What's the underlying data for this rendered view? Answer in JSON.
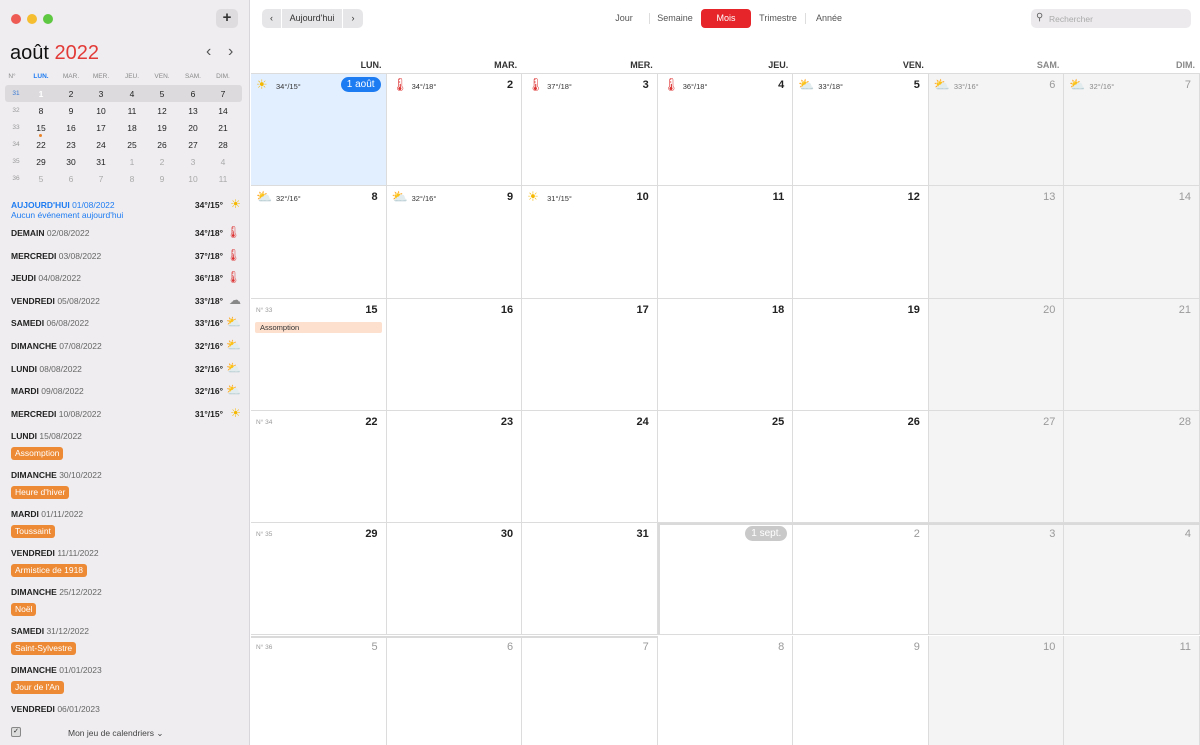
{
  "sidebar": {
    "add_label": "+",
    "month": "août",
    "year": "2022",
    "nav_prev": "‹",
    "nav_next": "›",
    "mini_headers": [
      "N°",
      "LUN.",
      "MAR.",
      "MER.",
      "JEU.",
      "VEN.",
      "SAM.",
      "DIM."
    ],
    "mini_weeks": [
      {
        "wk": "31",
        "days": [
          "1",
          "2",
          "3",
          "4",
          "5",
          "6",
          "7"
        ]
      },
      {
        "wk": "32",
        "days": [
          "8",
          "9",
          "10",
          "11",
          "12",
          "13",
          "14"
        ]
      },
      {
        "wk": "33",
        "days": [
          "15",
          "16",
          "17",
          "18",
          "19",
          "20",
          "21"
        ]
      },
      {
        "wk": "34",
        "days": [
          "22",
          "23",
          "24",
          "25",
          "26",
          "27",
          "28"
        ]
      },
      {
        "wk": "35",
        "days": [
          "29",
          "30",
          "31",
          "1",
          "2",
          "3",
          "4"
        ]
      },
      {
        "wk": "36",
        "days": [
          "5",
          "6",
          "7",
          "8",
          "9",
          "10",
          "11"
        ]
      }
    ],
    "today_label": "AUJOURD'HUI",
    "today_date": "01/08/2022",
    "today_temp": "34°/15°",
    "today_note": "Aucun événement aujourd'hui",
    "forecast": [
      {
        "day": "DEMAIN",
        "date": "02/08/2022",
        "temp": "34°/18°",
        "icon": "thermometer"
      },
      {
        "day": "MERCREDI",
        "date": "03/08/2022",
        "temp": "37°/18°",
        "icon": "thermometer"
      },
      {
        "day": "JEUDI",
        "date": "04/08/2022",
        "temp": "36°/18°",
        "icon": "thermometer"
      },
      {
        "day": "VENDREDI",
        "date": "05/08/2022",
        "temp": "33°/18°",
        "icon": "cloud"
      },
      {
        "day": "SAMEDI",
        "date": "06/08/2022",
        "temp": "33°/16°",
        "icon": "partly-cloudy"
      },
      {
        "day": "DIMANCHE",
        "date": "07/08/2022",
        "temp": "32°/16°",
        "icon": "partly-cloudy"
      },
      {
        "day": "LUNDI",
        "date": "08/08/2022",
        "temp": "32°/16°",
        "icon": "partly-cloudy"
      },
      {
        "day": "MARDI",
        "date": "09/08/2022",
        "temp": "32°/16°",
        "icon": "partly-cloudy"
      },
      {
        "day": "MERCREDI",
        "date": "10/08/2022",
        "temp": "31°/15°",
        "icon": "sun"
      }
    ],
    "holidays": [
      {
        "day": "LUNDI",
        "date": "15/08/2022",
        "tag": "Assomption"
      },
      {
        "day": "DIMANCHE",
        "date": "30/10/2022",
        "tag": "Heure d'hiver"
      },
      {
        "day": "MARDI",
        "date": "01/11/2022",
        "tag": "Toussaint"
      },
      {
        "day": "VENDREDI",
        "date": "11/11/2022",
        "tag": "Armistice de 1918"
      },
      {
        "day": "DIMANCHE",
        "date": "25/12/2022",
        "tag": "Noël"
      },
      {
        "day": "SAMEDI",
        "date": "31/12/2022",
        "tag": "Saint-Sylvestre"
      },
      {
        "day": "DIMANCHE",
        "date": "01/01/2023",
        "tag": "Jour de l'An"
      },
      {
        "day": "VENDREDI",
        "date": "06/01/2023",
        "tag": ""
      }
    ],
    "calendar_set": "Mon jeu de calendriers"
  },
  "toolbar": {
    "prev": "‹",
    "today": "Aujourd'hui",
    "next": "›",
    "views": [
      "Jour",
      "Semaine",
      "Mois",
      "Trimestre",
      "Année"
    ],
    "active_view": "Mois",
    "search_placeholder": "Rechercher"
  },
  "grid": {
    "headers": [
      "LUN.",
      "MAR.",
      "MER.",
      "JEU.",
      "VEN.",
      "SAM.",
      "DIM."
    ],
    "weeks": [
      {
        "wk": "",
        "cells": [
          {
            "n": "1 août",
            "badge": "blue",
            "wx": "sun",
            "t": "34°/15°"
          },
          {
            "n": "2",
            "wx": "thermometer",
            "t": "34°/18°"
          },
          {
            "n": "3",
            "wx": "thermometer",
            "t": "37°/18°"
          },
          {
            "n": "4",
            "wx": "thermometer",
            "t": "36°/18°"
          },
          {
            "n": "5",
            "wx": "partly-cloudy",
            "t": "33°/18°"
          },
          {
            "n": "6",
            "wx": "partly-cloudy",
            "t": "33°/16°"
          },
          {
            "n": "7",
            "wx": "partly-cloudy",
            "t": "32°/16°"
          }
        ]
      },
      {
        "wk": "",
        "cells": [
          {
            "n": "8",
            "wx": "partly-cloudy",
            "t": "32°/16°"
          },
          {
            "n": "9",
            "wx": "partly-cloudy",
            "t": "32°/16°"
          },
          {
            "n": "10",
            "wx": "sun",
            "t": "31°/15°"
          },
          {
            "n": "11"
          },
          {
            "n": "12"
          },
          {
            "n": "13"
          },
          {
            "n": "14"
          }
        ]
      },
      {
        "wk": "N° 33",
        "cells": [
          {
            "n": "15",
            "event": "Assomption"
          },
          {
            "n": "16"
          },
          {
            "n": "17"
          },
          {
            "n": "18"
          },
          {
            "n": "19"
          },
          {
            "n": "20"
          },
          {
            "n": "21"
          }
        ]
      },
      {
        "wk": "N° 34",
        "cells": [
          {
            "n": "22"
          },
          {
            "n": "23"
          },
          {
            "n": "24"
          },
          {
            "n": "25"
          },
          {
            "n": "26"
          },
          {
            "n": "27"
          },
          {
            "n": "28"
          }
        ]
      },
      {
        "wk": "N° 35",
        "cells": [
          {
            "n": "29"
          },
          {
            "n": "30"
          },
          {
            "n": "31"
          },
          {
            "n": "1 sept.",
            "badge": "grey",
            "other": true
          },
          {
            "n": "2",
            "other": true
          },
          {
            "n": "3",
            "other": true
          },
          {
            "n": "4",
            "other": true
          }
        ]
      },
      {
        "wk": "N° 36",
        "cells": [
          {
            "n": "5",
            "other": true
          },
          {
            "n": "6",
            "other": true
          },
          {
            "n": "7",
            "other": true
          },
          {
            "n": "8",
            "other": true
          },
          {
            "n": "9",
            "other": true
          },
          {
            "n": "10",
            "other": true
          },
          {
            "n": "11",
            "other": true
          }
        ]
      }
    ]
  },
  "colors": {
    "accent_blue": "#1e7cf2",
    "accent_red": "#e5252a",
    "holiday_orange": "#ec8a35",
    "event_bg": "#fde0ce"
  }
}
